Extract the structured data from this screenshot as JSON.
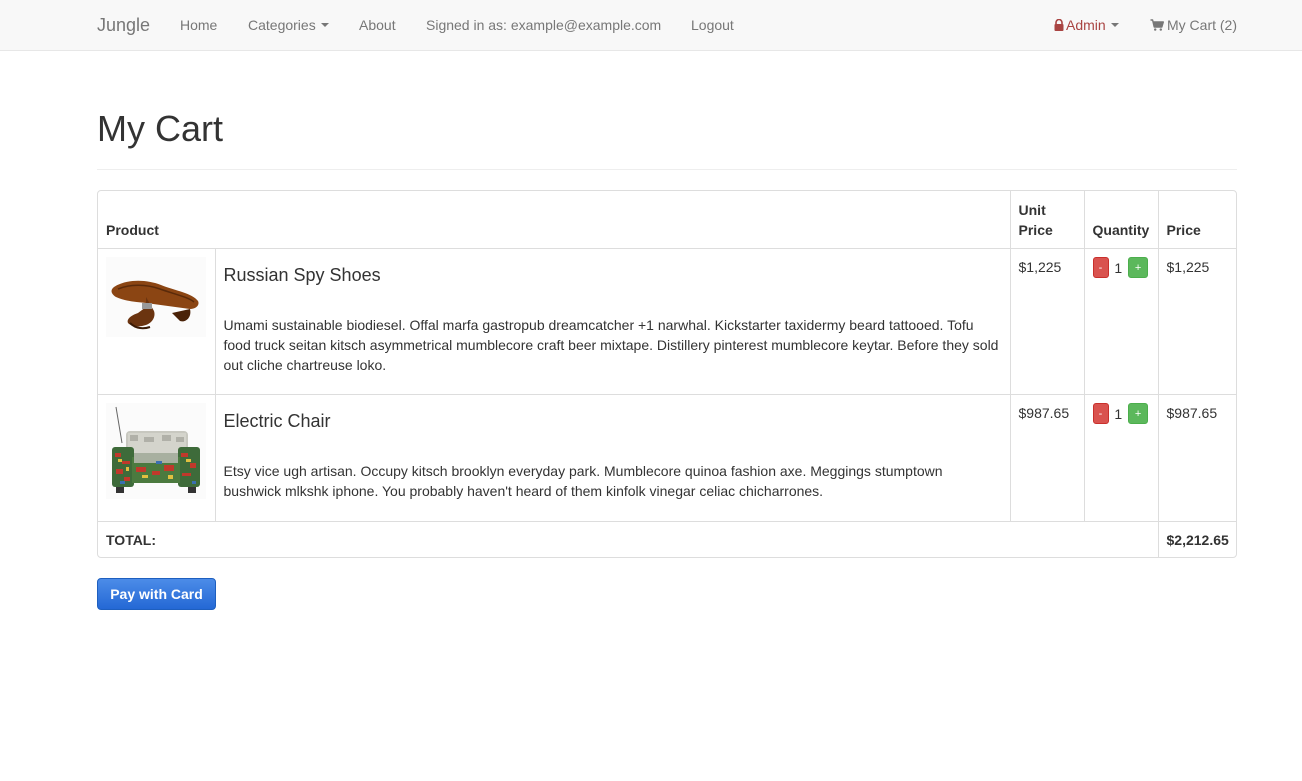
{
  "navbar": {
    "brand": "Jungle",
    "home": "Home",
    "categories": "Categories",
    "about": "About",
    "signed_in": "Signed in as: example@example.com",
    "logout": "Logout",
    "admin": "Admin",
    "cart": "My Cart (2)",
    "colors": {
      "admin": "#a94442",
      "link": "#777777",
      "background": "#f8f8f8"
    },
    "icons": {
      "admin": "lock-icon",
      "cart": "cart-icon"
    }
  },
  "page": {
    "title": "My Cart"
  },
  "table": {
    "headers": {
      "product": "Product",
      "unit_price": "Unit Price",
      "quantity": "Quantity",
      "price": "Price"
    },
    "items": [
      {
        "name": "Russian Spy Shoes",
        "description": "Umami sustainable biodiesel. Offal marfa gastropub dreamcatcher +1 narwhal. Kickstarter taxidermy beard tattooed. Tofu food truck seitan kitsch asymmetrical mumblecore craft beer mixtape. Distillery pinterest mumblecore keytar. Before they sold out cliche chartreuse loko.",
        "unit_price": "$1,225",
        "quantity": "1",
        "price": "$1,225",
        "minus": "-",
        "plus": "+"
      },
      {
        "name": "Electric Chair",
        "description": "Etsy vice ugh artisan. Occupy kitsch brooklyn everyday park. Mumblecore quinoa fashion axe. Meggings stumptown bushwick mlkshk iphone. You probably haven't heard of them kinfolk vinegar celiac chicharrones.",
        "unit_price": "$987.65",
        "quantity": "1",
        "price": "$987.65",
        "minus": "-",
        "plus": "+"
      }
    ],
    "total_label": "TOTAL:",
    "total_value": "$2,212.65"
  },
  "pay_button": {
    "label": "Pay with Card",
    "color": "#2f74dc"
  }
}
